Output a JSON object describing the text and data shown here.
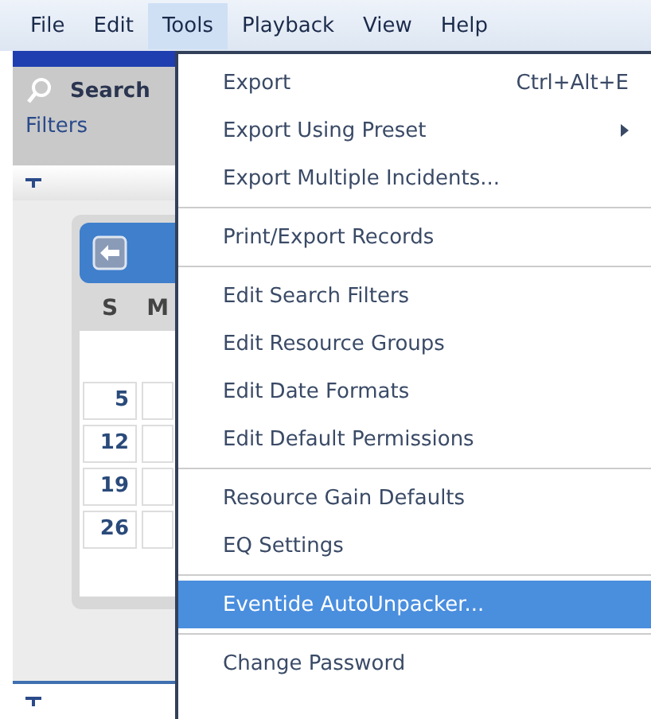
{
  "menubar": [
    {
      "label": "File",
      "selected": false
    },
    {
      "label": "Edit",
      "selected": false
    },
    {
      "label": "Tools",
      "selected": true
    },
    {
      "label": "Playback",
      "selected": false
    },
    {
      "label": "View",
      "selected": false
    },
    {
      "label": "Help",
      "selected": false
    }
  ],
  "search_panel": {
    "title": "Search",
    "filters": "Filters"
  },
  "calendar": {
    "day_headers": [
      "S",
      "M"
    ],
    "dates": [
      "5",
      "12",
      "19",
      "26"
    ]
  },
  "tools_menu": [
    {
      "kind": "item",
      "label": "Export",
      "shortcut": "Ctrl+Alt+E",
      "submenu": false,
      "selected": false
    },
    {
      "kind": "item",
      "label": "Export Using Preset",
      "submenu": true,
      "selected": false
    },
    {
      "kind": "item",
      "label": "Export Multiple Incidents...",
      "submenu": false,
      "selected": false
    },
    {
      "kind": "separator"
    },
    {
      "kind": "item",
      "label": "Print/Export Records",
      "submenu": false,
      "selected": false
    },
    {
      "kind": "separator"
    },
    {
      "kind": "item",
      "label": "Edit Search Filters",
      "submenu": false,
      "selected": false
    },
    {
      "kind": "item",
      "label": "Edit Resource Groups",
      "submenu": false,
      "selected": false
    },
    {
      "kind": "item",
      "label": "Edit Date Formats",
      "submenu": false,
      "selected": false
    },
    {
      "kind": "item",
      "label": "Edit Default Permissions",
      "submenu": false,
      "selected": false
    },
    {
      "kind": "separator"
    },
    {
      "kind": "item",
      "label": "Resource Gain Defaults",
      "submenu": false,
      "selected": false
    },
    {
      "kind": "item",
      "label": "EQ Settings",
      "submenu": false,
      "selected": false
    },
    {
      "kind": "separator"
    },
    {
      "kind": "item",
      "label": "Eventide AutoUnpacker...",
      "submenu": false,
      "selected": true
    },
    {
      "kind": "separator"
    },
    {
      "kind": "item",
      "label": "Change Password",
      "submenu": false,
      "selected": false
    }
  ]
}
